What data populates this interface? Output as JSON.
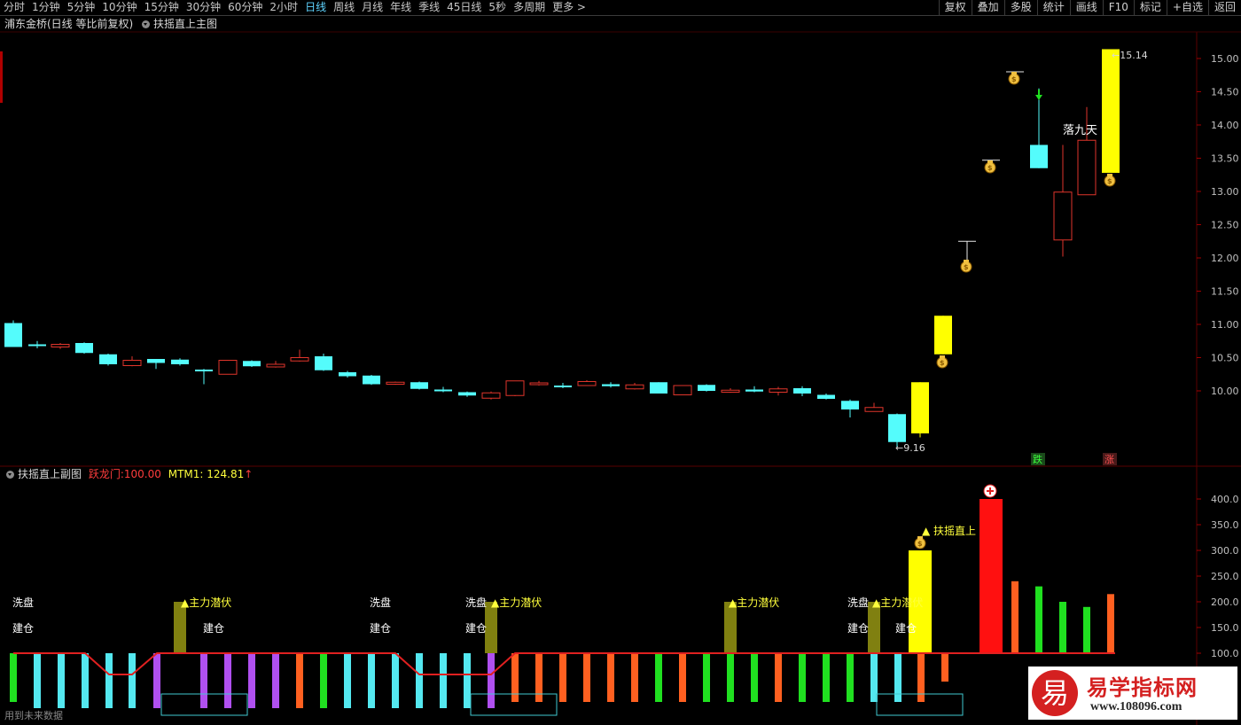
{
  "toolbar": {
    "periods": [
      "分时",
      "1分钟",
      "5分钟",
      "10分钟",
      "15分钟",
      "30分钟",
      "60分钟",
      "2小时",
      "日线",
      "周线",
      "月线",
      "年线",
      "季线",
      "45日线",
      "5秒",
      "多周期",
      "更多 >"
    ],
    "active_period": "日线",
    "right_buttons": [
      "复权",
      "叠加",
      "多股",
      "统计",
      "画线",
      "F10",
      "标记",
      "+自选",
      "返回"
    ]
  },
  "main_panel": {
    "title": "浦东金桥(日线 等比前复权)",
    "indicator": "扶摇直上主图",
    "label_luojiutian": "落九天",
    "low_price": "9.16",
    "high_price": "15.14",
    "tag_die": "跌",
    "tag_zhang": "涨",
    "y_ticks": [
      "15.00",
      "14.50",
      "14.00",
      "13.50",
      "13.00",
      "12.50",
      "12.00",
      "11.50",
      "11.00",
      "10.50",
      "10.00"
    ],
    "colors": {
      "up": "#e0352b",
      "down": "#54fcfc",
      "yellow": "#ffff00"
    },
    "icons": [
      "money-bag-icon",
      "green-arrow-icon"
    ]
  },
  "sub_panel": {
    "title": "扶摇直上副图",
    "yuelongmen_label": "跃龙门:",
    "yuelongmen_value": "100.00",
    "mtm_label": "MTM1:",
    "mtm_value": "124.81",
    "mtm_arrow": "↑",
    "y_ticks": [
      "400.0",
      "350.0",
      "300.0",
      "250.0",
      "200.0",
      "150.0",
      "100.0"
    ],
    "label_xipan": "洗盘",
    "label_jiancang": "建仓",
    "label_zhuli": "▲主力潜伏",
    "label_fuyao": "▲ 扶摇直上",
    "footer_note": "用到未来数据"
  },
  "watermark": {
    "logo_char": "易",
    "title": "易学指标网",
    "url": "www.108096.com"
  }
}
